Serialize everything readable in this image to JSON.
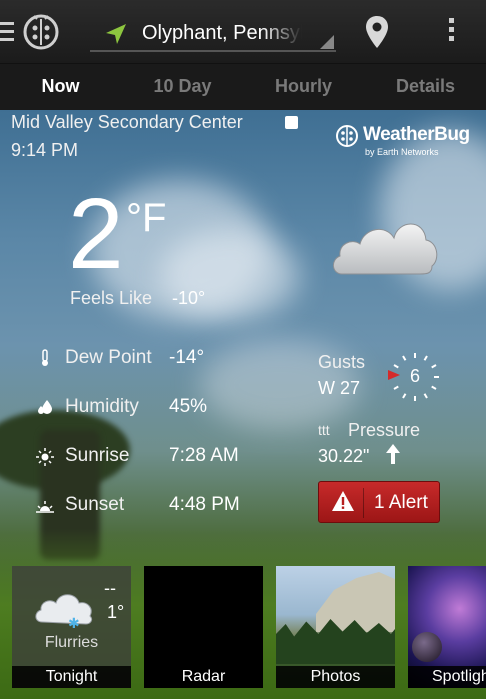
{
  "header": {
    "location": "Olyphant, Pennsylvania",
    "menu_icon": "menu-icon",
    "pin_icon": "map-pin-icon",
    "overflow_icon": "overflow-menu-icon"
  },
  "tabs": [
    {
      "label": "Now",
      "active": true
    },
    {
      "label": "10 Day",
      "active": false
    },
    {
      "label": "Hourly",
      "active": false
    },
    {
      "label": "Details",
      "active": false
    }
  ],
  "now": {
    "station": "Mid Valley Secondary Center",
    "time": "9:14 PM",
    "brand": {
      "name": "WeatherBug",
      "sub": "by Earth Networks"
    },
    "temperature": "2",
    "temperature_unit": "°F",
    "feels_like_label": "Feels Like",
    "feels_like_value": "-10°",
    "dew_point_label": "Dew Point",
    "dew_point_value": "-14°",
    "humidity_label": "Humidity",
    "humidity_value": "45%",
    "sunrise_label": "Sunrise",
    "sunrise_value": "7:28 AM",
    "sunset_label": "Sunset",
    "sunset_value": "4:48 PM",
    "gusts_label": "Gusts",
    "gusts_value": "W 27",
    "wind_speed": "6",
    "pressure_label": "Pressure",
    "pressure_value": "30.22\"",
    "alert_text": "1 Alert"
  },
  "tiles": [
    {
      "label": "Tonight",
      "temp_high": "--",
      "temp_low": "1°",
      "desc": "Flurries"
    },
    {
      "label": "Radar"
    },
    {
      "label": "Photos"
    },
    {
      "label": "Spotlight"
    }
  ],
  "colors": {
    "accent": "#2aa0e0",
    "alert": "#b71f1f",
    "wind_direction_marker": "#d42a2a"
  }
}
